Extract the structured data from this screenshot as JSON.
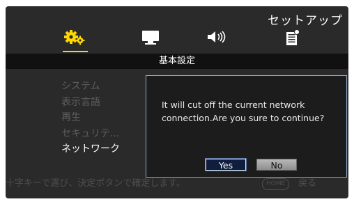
{
  "header": {
    "title": "セットアップ",
    "icons": [
      {
        "name": "settings-gear-icon",
        "selected": true
      },
      {
        "name": "display-icon",
        "selected": false
      },
      {
        "name": "speaker-audio-icon",
        "selected": false
      },
      {
        "name": "document-info-icon",
        "selected": false
      }
    ],
    "accent_color": "#ffd800"
  },
  "section": {
    "title": "基本設定"
  },
  "menu": {
    "items": [
      {
        "label": "システム",
        "active": false
      },
      {
        "label": "表示言語",
        "active": false
      },
      {
        "label": "再生",
        "active": false
      },
      {
        "label": "セキュリテ...",
        "active": false
      },
      {
        "label": "ネットワーク",
        "active": true
      }
    ]
  },
  "dialog": {
    "line1": "It will cut off the current network",
    "line2": "connection.Are you sure to continue?",
    "yes_label": "Yes",
    "no_label": "No"
  },
  "footer": {
    "hint": "十字キーで選び、決定ボタンで確定します。",
    "home_label": "HOME",
    "back_label": "戻る"
  }
}
